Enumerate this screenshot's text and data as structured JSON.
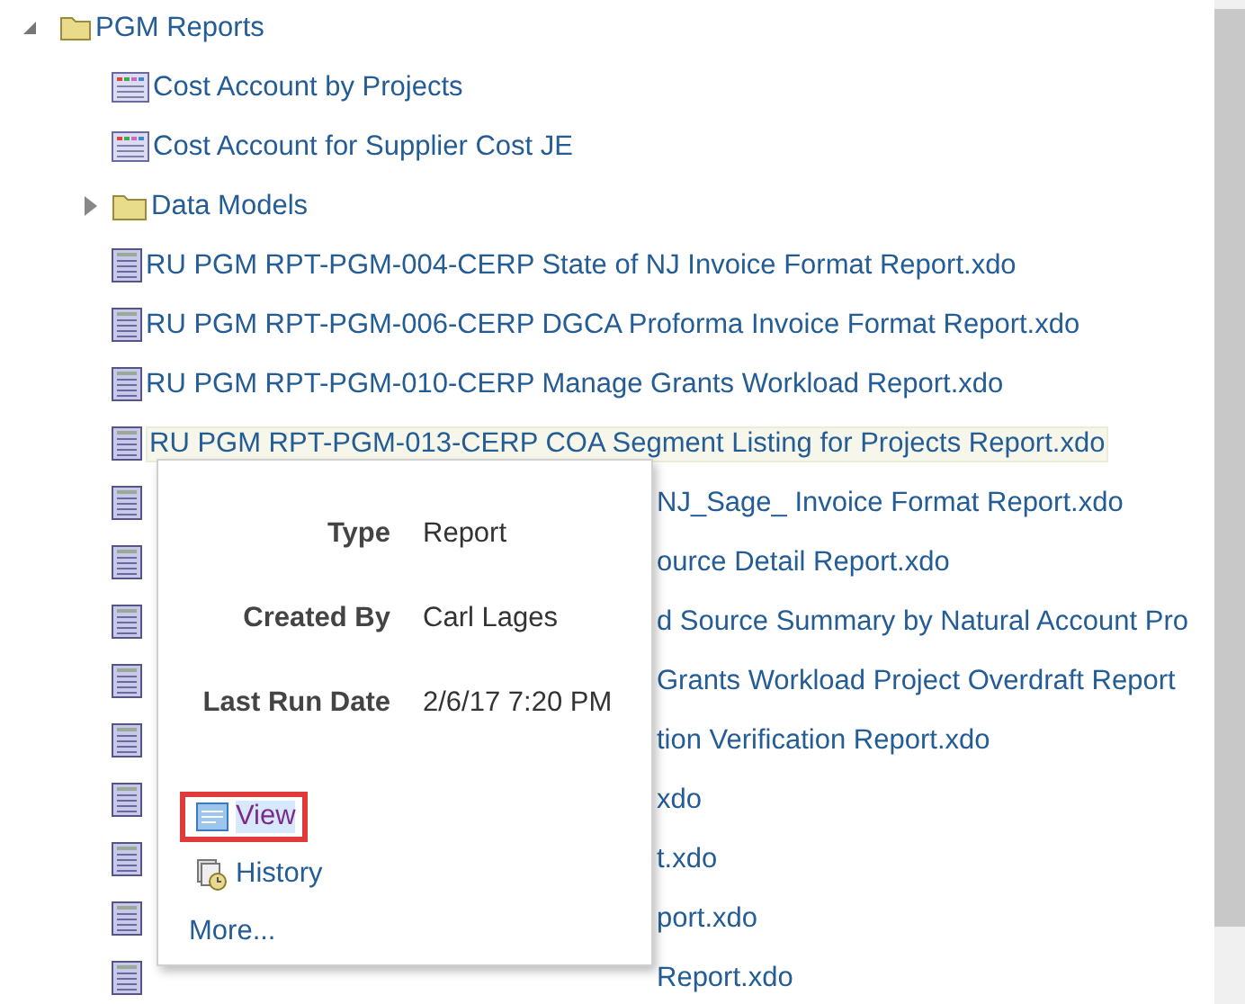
{
  "tree": {
    "label": "PGM Reports",
    "expanded": true,
    "children": [
      {
        "kind": "analysis",
        "label": "Cost Account by Projects",
        "selected": false
      },
      {
        "kind": "analysis",
        "label": "Cost Account for Supplier Cost JE",
        "selected": false
      },
      {
        "kind": "folder",
        "label": "Data Models",
        "expanded": false,
        "selected": false
      },
      {
        "kind": "report",
        "label": "RU PGM RPT-PGM-004-CERP State of NJ Invoice Format Report.xdo",
        "selected": false
      },
      {
        "kind": "report",
        "label": "RU PGM RPT-PGM-006-CERP DGCA Proforma Invoice Format Report.xdo",
        "selected": false
      },
      {
        "kind": "report",
        "label": "RU PGM RPT-PGM-010-CERP Manage Grants Workload Report.xdo",
        "selected": false
      },
      {
        "kind": "report",
        "label": "RU PGM RPT-PGM-013-CERP COA Segment Listing for Projects Report.xdo",
        "selected": true
      },
      {
        "kind": "report",
        "label": "NJ_Sage_ Invoice Format Report.xdo",
        "covered": true,
        "selected": false
      },
      {
        "kind": "report",
        "label": "ource Detail Report.xdo",
        "covered": true,
        "selected": false
      },
      {
        "kind": "report",
        "label": "d Source Summary by Natural Account Pro",
        "covered": true,
        "selected": false
      },
      {
        "kind": "report",
        "label": "Grants Workload Project Overdraft Report",
        "covered": true,
        "selected": false
      },
      {
        "kind": "report",
        "label": "tion Verification Report.xdo",
        "covered": true,
        "selected": false
      },
      {
        "kind": "report",
        "label": "xdo",
        "covered": true,
        "selected": false
      },
      {
        "kind": "report",
        "label": "t.xdo",
        "covered": true,
        "selected": false
      },
      {
        "kind": "report",
        "label": "port.xdo",
        "covered": true,
        "selected": false
      },
      {
        "kind": "report",
        "label": "Report.xdo",
        "covered": true,
        "selected": false
      }
    ]
  },
  "popup": {
    "fields": [
      {
        "label": "Type",
        "value": "Report"
      },
      {
        "label": "Created By",
        "value": "Carl Lages"
      },
      {
        "label": "Last Run Date",
        "value": "2/6/17 7:20 PM"
      }
    ],
    "actions": [
      {
        "kind": "view",
        "label": "View",
        "highlighted": true
      },
      {
        "kind": "history",
        "label": "History",
        "highlighted": false
      },
      {
        "kind": "more",
        "label": "More...",
        "highlighted": false
      }
    ]
  }
}
